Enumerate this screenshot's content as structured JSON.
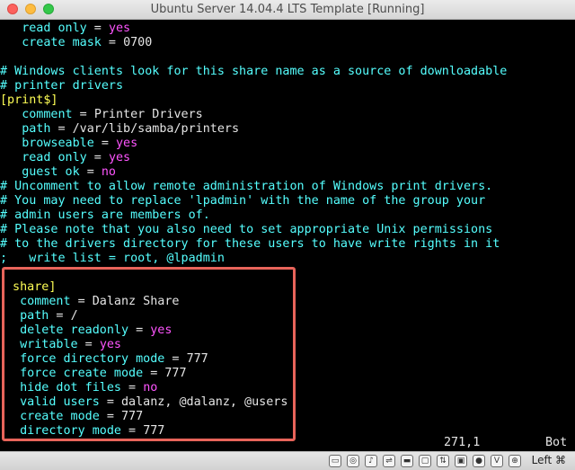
{
  "window": {
    "title": "Ubuntu Server 14.04.4 LTS Template [Running]"
  },
  "terminal": {
    "lines": [
      {
        "indent": "   ",
        "key": "read only",
        "sep": " = ",
        "value": "yes",
        "value_color": "magenta"
      },
      {
        "indent": "   ",
        "key": "create mask",
        "sep": " = ",
        "value": "0700",
        "value_color": "white"
      },
      {
        "comment": ""
      },
      {
        "comment": "# Windows clients look for this share name as a source of downloadable"
      },
      {
        "comment": "# printer drivers"
      },
      {
        "section": "[print$]"
      },
      {
        "indent": "   ",
        "key": "comment",
        "sep": " = ",
        "value": "Printer Drivers",
        "value_color": "white"
      },
      {
        "indent": "   ",
        "key": "path",
        "sep": " = ",
        "value": "/var/lib/samba/printers",
        "value_color": "white"
      },
      {
        "indent": "   ",
        "key": "browseable",
        "sep": " = ",
        "value": "yes",
        "value_color": "magenta"
      },
      {
        "indent": "   ",
        "key": "read only",
        "sep": " = ",
        "value": "yes",
        "value_color": "magenta"
      },
      {
        "indent": "   ",
        "key": "guest ok",
        "sep": " = ",
        "value": "no",
        "value_color": "magenta"
      },
      {
        "comment": "# Uncomment to allow remote administration of Windows print drivers."
      },
      {
        "comment": "# You may need to replace 'lpadmin' with the name of the group your"
      },
      {
        "comment": "# admin users are members of."
      },
      {
        "comment": "# Please note that you also need to set appropriate Unix permissions"
      },
      {
        "comment": "# to the drivers directory for these users to have write rights in it"
      },
      {
        "comment": ";   write list = root, @lpadmin"
      },
      {
        "comment": ""
      },
      {
        "section": " share]"
      },
      {
        "indent": "  ",
        "key": "comment",
        "sep": " = ",
        "value": "Dalanz Share",
        "value_color": "white"
      },
      {
        "indent": "  ",
        "key": "path",
        "sep": " = ",
        "value": "/",
        "value_color": "white"
      },
      {
        "indent": "  ",
        "key": "delete readonly",
        "sep": " = ",
        "value": "yes",
        "value_color": "magenta"
      },
      {
        "indent": "  ",
        "key": "writable",
        "sep": " = ",
        "value": "yes",
        "value_color": "magenta"
      },
      {
        "indent": "  ",
        "key": "force directory mode",
        "sep": " = ",
        "value": "777",
        "value_color": "white"
      },
      {
        "indent": "  ",
        "key": "force create mode",
        "sep": " = ",
        "value": "777",
        "value_color": "white"
      },
      {
        "indent": "  ",
        "key": "hide dot files",
        "sep": " = ",
        "value": "no",
        "value_color": "magenta"
      },
      {
        "indent": "  ",
        "key": "valid users",
        "sep": " = ",
        "value": "dalanz, @dalanz, @users",
        "value_color": "white"
      },
      {
        "indent": "  ",
        "key": "create mode",
        "sep": " = ",
        "value": "777",
        "value_color": "white"
      },
      {
        "indent": "  ",
        "key": "directory mode",
        "sep": " = ",
        "value": "777",
        "value_color": "white"
      }
    ],
    "cursor_position": "271,1",
    "scroll_position": "Bot"
  },
  "statusbar": {
    "icons": [
      "hard-disk-icon",
      "optical-disk-icon",
      "audio-icon",
      "usb-icon",
      "shared-folder-icon",
      "display-icon",
      "network-icon",
      "video-capture-icon",
      "recording-icon",
      "cpu-icon",
      "mouse-integration-icon"
    ],
    "host_key_label": "Left ⌘"
  },
  "colors": {
    "terminal_bg": "#000000",
    "cyan": "#55ffff",
    "yellow": "#ffff55",
    "magenta": "#ff55ff",
    "white": "#e5e5e5",
    "highlight_border": "#e8645a"
  }
}
